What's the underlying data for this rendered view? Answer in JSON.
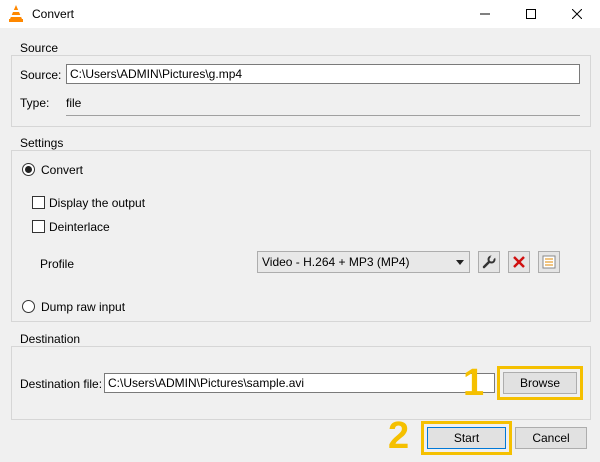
{
  "window": {
    "title": "Convert"
  },
  "source": {
    "group_label": "Source",
    "source_label": "Source:",
    "source_value": "C:\\Users\\ADMIN\\Pictures\\g.mp4",
    "type_label": "Type:",
    "type_value": "file"
  },
  "settings": {
    "group_label": "Settings",
    "convert_label": "Convert",
    "display_output_label": "Display the output",
    "deinterlace_label": "Deinterlace",
    "profile_label": "Profile",
    "profile_selected": "Video - H.264 + MP3 (MP4)",
    "dump_raw_label": "Dump raw input"
  },
  "destination": {
    "group_label": "Destination",
    "file_label": "Destination file:",
    "file_value": "C:\\Users\\ADMIN\\Pictures\\sample.avi",
    "browse_label": "Browse"
  },
  "buttons": {
    "start_label": "Start",
    "cancel_label": "Cancel"
  },
  "annotations": {
    "step1": "1",
    "step2": "2",
    "color": "#f5c000"
  }
}
